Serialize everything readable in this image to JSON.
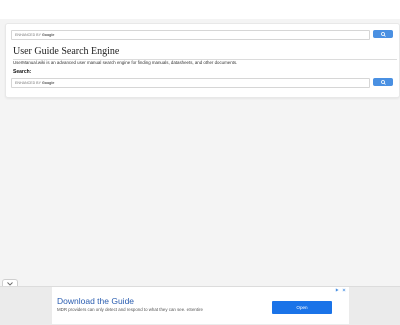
{
  "search": {
    "powered_by": "ENHANCED BY",
    "brand": "Google",
    "button_icon": "search-icon"
  },
  "page": {
    "title": "User Guide Search Engine",
    "description": "UserManual.wiki is an advanced user manual search engine for finding manuals, datasheets, and other documents.",
    "search_label": "Search:"
  },
  "ad": {
    "title": "Download the Guide",
    "description": "MDR providers can only detect and respond to what they can see. eSentire",
    "cta": "Open",
    "icons": [
      "adchoices-icon",
      "close-icon"
    ]
  },
  "colors": {
    "accent": "#4a90e2",
    "ad_link": "#2a5db0",
    "ad_button": "#1a73e8"
  }
}
